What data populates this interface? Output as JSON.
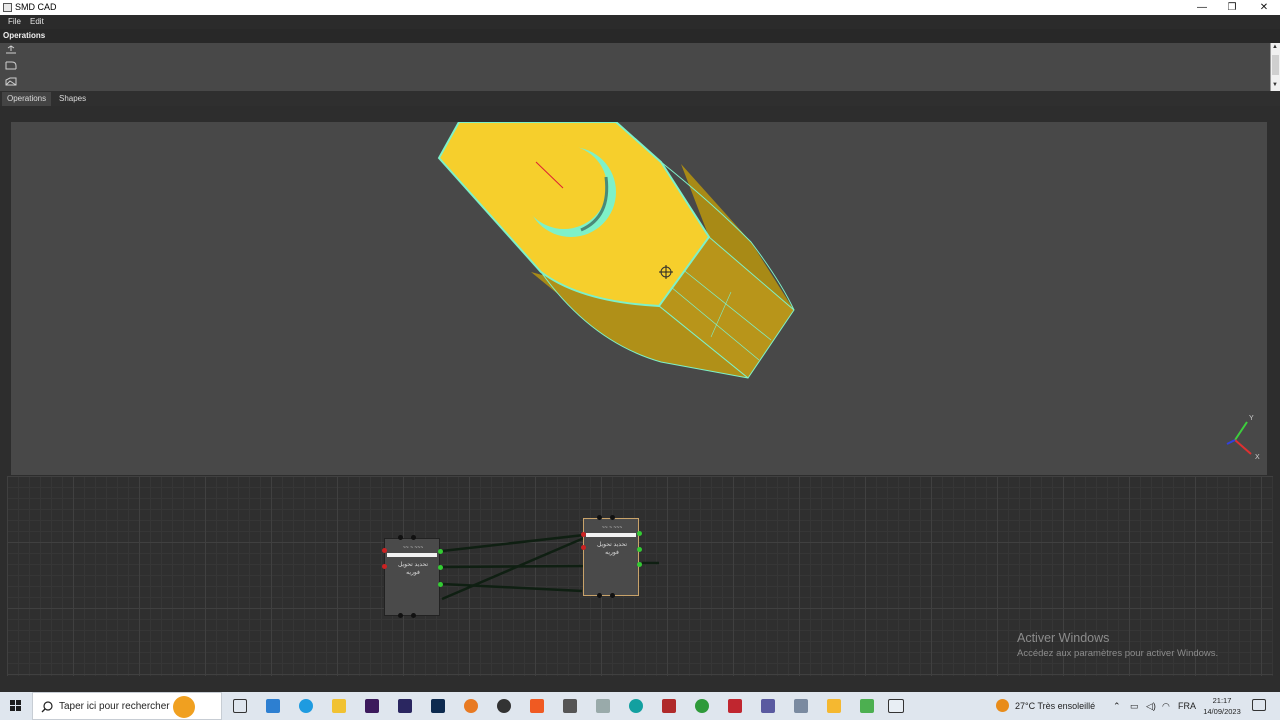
{
  "window": {
    "title": "SMD CAD",
    "minimize": "—",
    "maximize": "❐",
    "close": "✕"
  },
  "menu": {
    "file": "File",
    "edit": "Edit"
  },
  "operations_header": "Operations",
  "tabs": [
    {
      "label": "Operations",
      "active": true
    },
    {
      "label": "Shapes",
      "active": false
    }
  ],
  "viewport": {
    "axis_y": "Y",
    "axis_x": "X"
  },
  "nodes": [
    {
      "caption": "~~ ~ ~~~",
      "text_line1": "تحديد تحويل",
      "text_line2": "فوريه"
    },
    {
      "caption": "~~ ~ ~~~",
      "text_line1": "تحديد تحويل",
      "text_line2": "فوريه"
    }
  ],
  "watermark": {
    "line1": "Activer Windows",
    "line2": "Accédez aux paramètres pour activer Windows."
  },
  "taskbar": {
    "search_placeholder": "Taper ici pour rechercher",
    "weather": "27°C  Très ensoleillé",
    "lang": "FRA",
    "time": "21:17",
    "date": "14/09/2023"
  },
  "colors": {
    "shape_yellow": "#f6cf2c",
    "shape_edge": "#7ef1c8",
    "viewport_bg": "#484848"
  }
}
